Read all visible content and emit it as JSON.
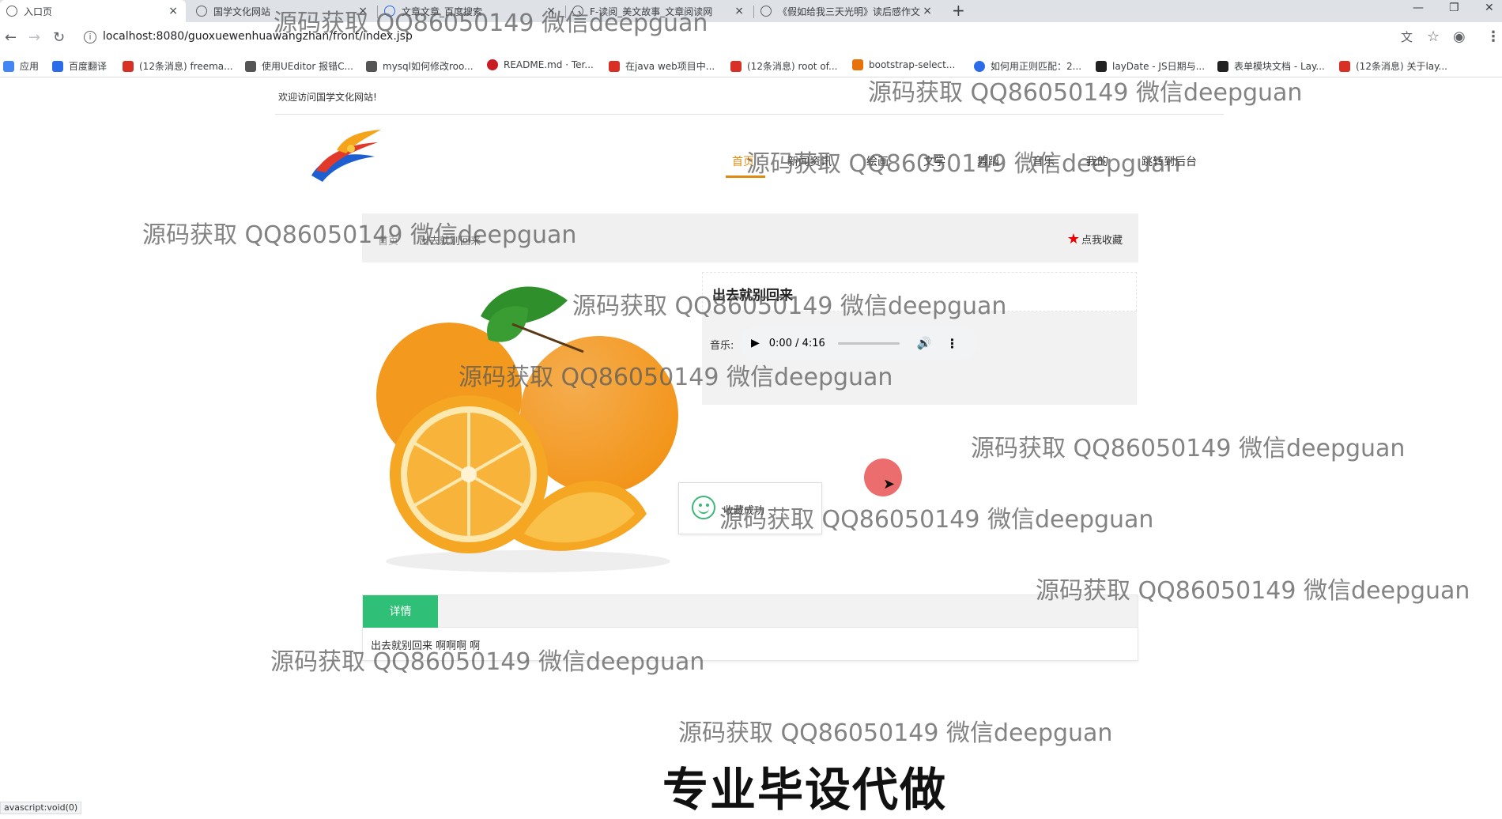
{
  "browser": {
    "tabs": [
      {
        "label": "入口页",
        "active": true
      },
      {
        "label": "国学文化网站",
        "active": false
      },
      {
        "label": "文章文章_百度搜索",
        "active": false
      },
      {
        "label": "F-读阅_美文故事_文章阅读网",
        "active": false
      },
      {
        "label": "《假如给我三天光明》读后感作文",
        "active": false
      }
    ],
    "close_glyph": "×",
    "new_tab": "+",
    "url": "localhost:8080/guoxuewenhuawangzhan/front/index.jsp",
    "bookmarks": [
      {
        "label": "应用",
        "color": "#4285f4"
      },
      {
        "label": "百度翻译",
        "color": "#2b6de8"
      },
      {
        "label": "(12条消息) freema...",
        "color": "#d93025"
      },
      {
        "label": "使用UEditor 报错C...",
        "color": "#555555"
      },
      {
        "label": "mysql如何修改roo...",
        "color": "#555555"
      },
      {
        "label": "README.md · Ter...",
        "color": "#c71d23"
      },
      {
        "label": "在java web项目中...",
        "color": "#d93025"
      },
      {
        "label": "(12条消息) root of...",
        "color": "#d93025"
      },
      {
        "label": "bootstrap-select...",
        "color": "#e8710a"
      },
      {
        "label": "如何用正则匹配：2...",
        "color": "#2b6de8"
      },
      {
        "label": "layDate - JS日期与...",
        "color": "#222222"
      },
      {
        "label": "表单模块文档 - Lay...",
        "color": "#222222"
      },
      {
        "label": "(12条消息) 关于lay...",
        "color": "#d93025"
      }
    ],
    "status_text": "avascript:void(0)"
  },
  "site": {
    "welcome": "欢迎访问国学文化网站!",
    "nav": [
      {
        "label": "首页",
        "active": true
      },
      {
        "label": "新闻资讯",
        "active": false
      },
      {
        "label": "绘画",
        "active": false
      },
      {
        "label": "文学",
        "active": false
      },
      {
        "label": "舞蹈",
        "active": false
      },
      {
        "label": "音乐",
        "active": false
      },
      {
        "label": "我的",
        "active": false
      },
      {
        "label": "跳转到后台",
        "active": false
      }
    ],
    "accent_color": "#e08b10"
  },
  "breadcrumb": {
    "home": "首页",
    "current": "出去就别回来"
  },
  "favorite": {
    "label": "点我收藏",
    "icon": "star-icon"
  },
  "item": {
    "title": "出去就别回来",
    "music_label": "音乐:",
    "audio_time": "0:00 / 4:16",
    "image": "orange-fruit-image"
  },
  "toast": {
    "message": "收藏成功",
    "icon": "smile-icon"
  },
  "detail": {
    "tab_label": "详情",
    "content": "出去就别回来 啊啊啊 啊",
    "tab_color": "#2fbf77"
  },
  "overlay": {
    "watermark": "源码获取 QQ86050149 微信deepguan",
    "banner": "专业毕设代做"
  }
}
